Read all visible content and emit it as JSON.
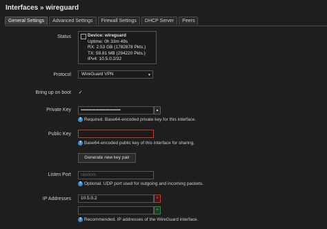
{
  "page": {
    "title": "Interfaces » wireguard"
  },
  "tabs": [
    {
      "label": "General Settings",
      "active": true
    },
    {
      "label": "Advanced Settings"
    },
    {
      "label": "Firewall Settings"
    },
    {
      "label": "DHCP Server"
    },
    {
      "label": "Peers"
    }
  ],
  "status": {
    "label": "Status",
    "device": "Device: wireguard",
    "uptime": "Uptime: 0h 33m 49s",
    "rx": "RX: 2.53 GB (1782878 Pkts.)",
    "tx": "TX: 59.81 MB (294220 Pkts.)",
    "ipv4": "IPv4: 10.5.0.2/32"
  },
  "protocol": {
    "label": "Protocol",
    "value": "WireGuard VPN"
  },
  "boot": {
    "label": "Bring up on boot",
    "checked": "✓"
  },
  "private_key": {
    "label": "Private Key",
    "value": "••••••••••••••••••••••••••••••••••••••••••••••",
    "toggle": "▴",
    "help": "Required. Base64-encoded private key for this interface."
  },
  "public_key": {
    "label": "Public Key",
    "value": "",
    "help": "Base64-encoded public key of this interface for sharing.",
    "generate_button": "Generate new key pair"
  },
  "listen_port": {
    "label": "Listen Port",
    "placeholder": "random",
    "help": "Optional. UDP port used for outgoing and incoming packets."
  },
  "ip_addresses": {
    "label": "IP Addresses",
    "values": [
      "10.5.0.2",
      ""
    ],
    "remove_symbol": "×",
    "add_symbol": "+",
    "help": "Recommended. IP addresses of the WireGuard interface."
  },
  "colors": {
    "background": "#1e1e1e",
    "help_icon": "#3b8fd1",
    "error_border": "#c0392b",
    "add_green": "#4cbf6a"
  }
}
